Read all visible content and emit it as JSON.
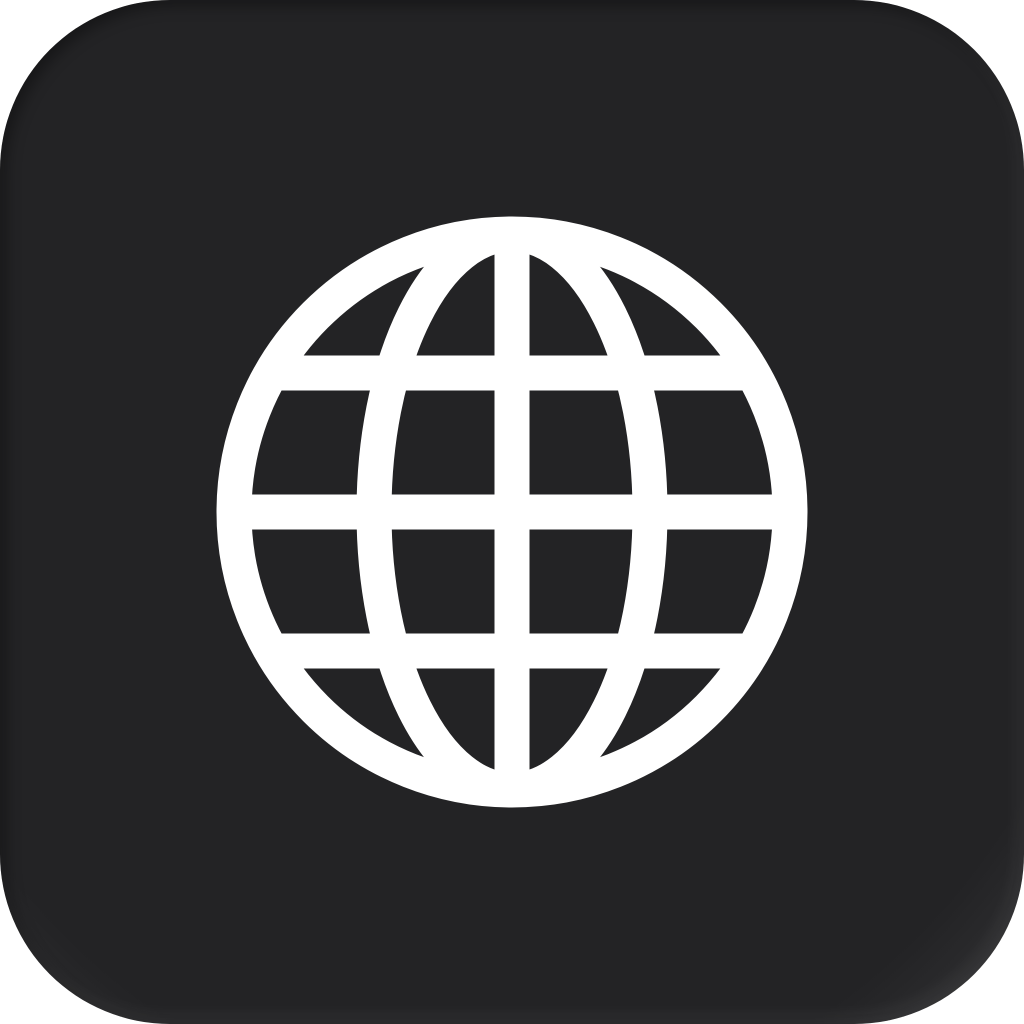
{
  "app_icon": {
    "icon": "globe-icon",
    "background_color": "#232325",
    "foreground_color": "#ffffff"
  }
}
